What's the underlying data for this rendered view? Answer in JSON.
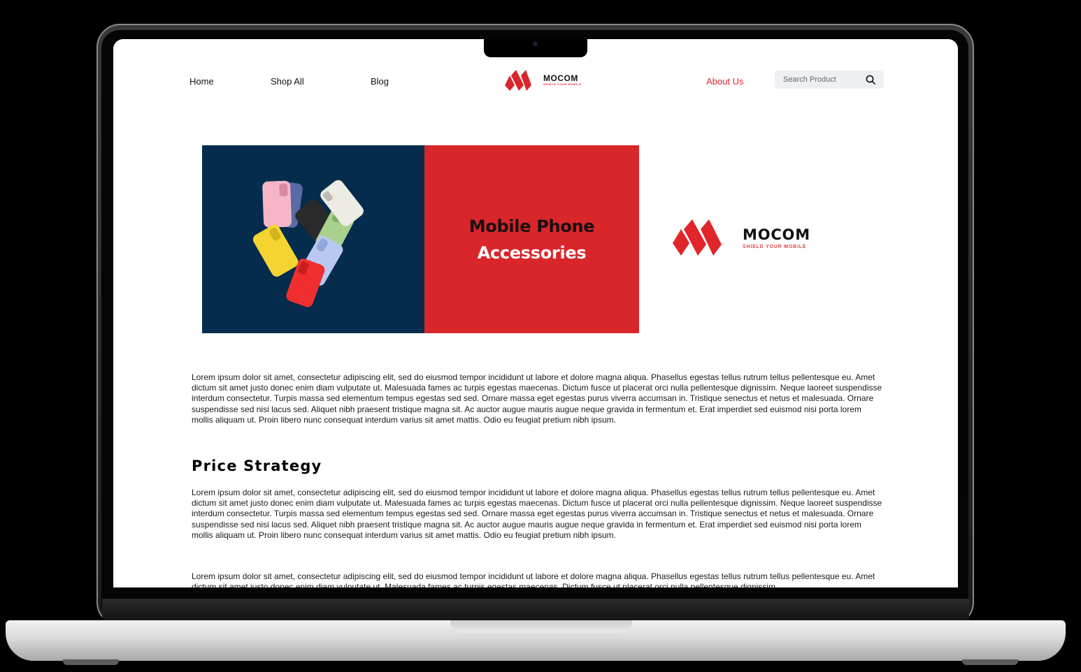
{
  "nav": {
    "home": "Home",
    "shop_all": "Shop All",
    "blog": "Blog",
    "about_us": "About Us"
  },
  "brand": {
    "name": "MOCOM",
    "tagline": "SHIELD YOUR MOBILE"
  },
  "search": {
    "placeholder": "Search Product"
  },
  "hero": {
    "title_line1": "Mobile Phone",
    "title_line2": "Accessories"
  },
  "content": {
    "intro": "Lorem ipsum dolor sit amet, consectetur adipiscing elit, sed do eiusmod tempor incididunt ut labore et dolore magna aliqua. Phasellus egestas tellus rutrum tellus pellentesque eu. Amet dictum sit amet justo donec enim diam vulputate ut. Malesuada fames ac turpis egestas maecenas. Dictum fusce ut placerat orci nulla pellentesque dignissim. Neque laoreet suspendisse interdum consectetur. Turpis massa sed elementum tempus egestas sed sed. Ornare massa eget egestas purus viverra accumsan in. Tristique senectus et netus et malesuada. Ornare suspendisse sed nisi lacus sed. Aliquet nibh praesent tristique magna sit. Ac auctor augue mauris augue neque gravida in fermentum et. Erat imperdiet sed euismod nisi porta lorem mollis aliquam ut. Proin libero nunc consequat interdum varius sit amet mattis. Odio eu feugiat pretium nibh ipsum.",
    "section_heading": "Price Strategy",
    "section_body": "Lorem ipsum dolor sit amet, consectetur adipiscing elit, sed do eiusmod tempor incididunt ut labore et dolore magna aliqua. Phasellus egestas tellus rutrum tellus pellentesque eu. Amet dictum sit amet justo donec enim diam vulputate ut. Malesuada fames ac turpis egestas maecenas. Dictum fusce ut placerat orci nulla pellentesque dignissim. Neque laoreet suspendisse interdum consectetur. Turpis massa sed elementum tempus egestas sed sed. Ornare massa eget egestas purus viverra accumsan in. Tristique senectus et netus et malesuada. Ornare suspendisse sed nisi lacus sed. Aliquet nibh praesent tristique magna sit. Ac auctor augue mauris augue neque gravida in fermentum et. Erat imperdiet sed euismod nisi porta lorem mollis aliquam ut. Proin libero nunc consequat interdum varius sit amet mattis. Odio eu feugiat pretium nibh ipsum.",
    "section_body_2": "Lorem ipsum dolor sit amet, consectetur adipiscing elit, sed do eiusmod tempor incididunt ut labore et dolore magna aliqua. Phasellus egestas tellus rutrum tellus pellentesque eu. Amet dictum sit amet justo donec enim diam vulputate ut. Malesuada fames ac turpis egestas maecenas. Dictum fusce ut placerat orci nulla pellentesque dignissim."
  },
  "colors": {
    "accent_red": "#d8262b",
    "hero_navy": "#052c4d",
    "search_bg": "#eef0f3"
  }
}
